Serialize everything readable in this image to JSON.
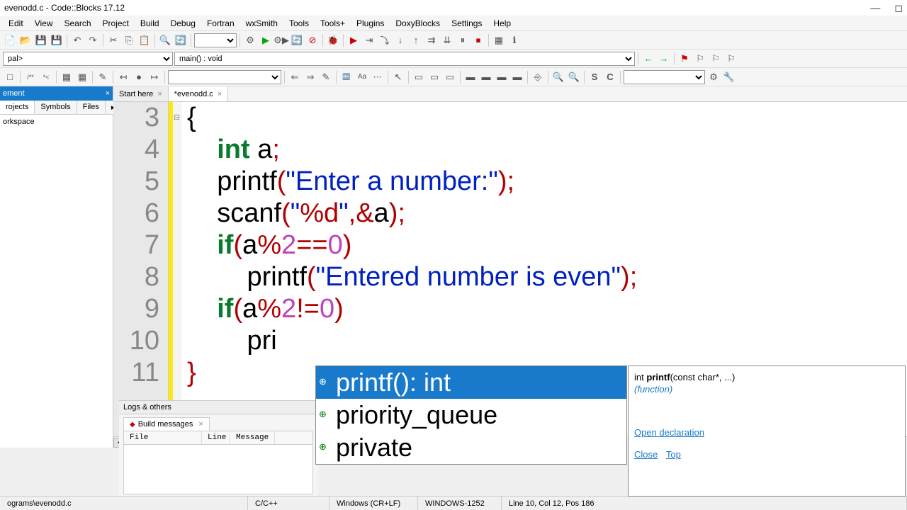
{
  "window": {
    "title": "evenodd.c - Code::Blocks 17.12"
  },
  "menu": [
    "Edit",
    "View",
    "Search",
    "Project",
    "Build",
    "Debug",
    "Fortran",
    "wxSmith",
    "Tools",
    "Tools+",
    "Plugins",
    "DoxyBlocks",
    "Settings",
    "Help"
  ],
  "scope_dropdown": "pal>",
  "function_dropdown": "main() : void",
  "sidebar": {
    "header": "ement",
    "tabs": [
      "rojects",
      "Symbols",
      "Files"
    ],
    "tree_root": "orkspace"
  },
  "editor": {
    "tabs": [
      {
        "label": "Start here",
        "active": false
      },
      {
        "label": "*evenodd.c",
        "active": true
      }
    ],
    "lines": [
      {
        "n": "3",
        "indent": 0,
        "html": "<span class='brace'>{</span>"
      },
      {
        "n": "4",
        "indent": 2,
        "html": "<span class='kw'>int</span> a<span class='op'>;</span>"
      },
      {
        "n": "5",
        "indent": 2,
        "html": "printf<span class='op'>(</span><span class='str'>\"Enter a number:\"</span><span class='op'>);</span>"
      },
      {
        "n": "6",
        "indent": 2,
        "html": "scanf<span class='op'>(</span><span class='str'>\"</span><span class='fmt'>%d</span><span class='str'>\"</span><span class='op'>,&amp;</span>a<span class='op'>);</span>"
      },
      {
        "n": "7",
        "indent": 2,
        "html": "<span class='kw'>if</span><span class='op'>(</span>a<span class='op'>%</span><span class='num'>2</span><span class='op'>==</span><span class='num'>0</span><span class='op'>)</span>"
      },
      {
        "n": "8",
        "indent": 4,
        "html": "printf<span class='op'>(</span><span class='str'>\"Entered number is even\"</span><span class='op'>);</span>"
      },
      {
        "n": "9",
        "indent": 2,
        "html": "<span class='kw'>if</span><span class='op'>(</span>a<span class='op'>%</span><span class='num'>2</span><span class='op'>!=</span><span class='num'>0</span><span class='op'>)</span>"
      },
      {
        "n": "10",
        "indent": 4,
        "html": "pri"
      },
      {
        "n": "11",
        "indent": 0,
        "html": "<span class='brace' style='color:#b00000'>}</span>"
      }
    ]
  },
  "autocomplete": {
    "items": [
      {
        "label": "printf(): int",
        "selected": true
      },
      {
        "label": "priority_queue",
        "selected": false
      },
      {
        "label": "private",
        "selected": false
      }
    ]
  },
  "tooltip": {
    "sig_prefix": "int ",
    "sig_name": "printf",
    "sig_suffix": "(const char*, ...)",
    "kind": "(function)",
    "links": [
      "Open declaration",
      "Close",
      "Top"
    ]
  },
  "logs": {
    "header": "Logs & others",
    "tab": "Build messages",
    "columns": [
      "File",
      "Line",
      "Message"
    ]
  },
  "status": {
    "path": "ograms\\evenodd.c",
    "lang": "C/C++",
    "eol": "Windows (CR+LF)",
    "encoding": "WINDOWS-1252",
    "pos": "Line 10, Col 12, Pos 186"
  }
}
